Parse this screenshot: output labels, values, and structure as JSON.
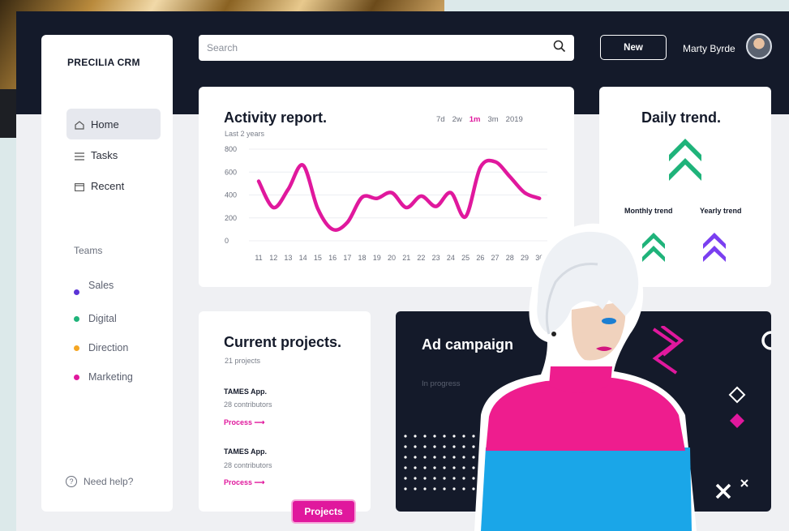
{
  "app": {
    "brand": "PRECILIA CRM"
  },
  "header": {
    "search_placeholder": "Search",
    "new_label": "New",
    "user_name": "Marty Byrde"
  },
  "sidebar": {
    "items": [
      {
        "label": "Home",
        "icon": "home-icon"
      },
      {
        "label": "Tasks",
        "icon": "list-icon"
      },
      {
        "label": "Recent",
        "icon": "recent-icon"
      }
    ],
    "teams_label": "Teams",
    "teams": [
      {
        "label": "Sales",
        "color": "#5b34d6"
      },
      {
        "label": "Digital",
        "color": "#1fb37a"
      },
      {
        "label": "Direction",
        "color": "#f5a623"
      },
      {
        "label": "Marketing",
        "color": "#e0189d"
      }
    ],
    "help_label": "Need help?"
  },
  "activity": {
    "title": "Activity report.",
    "subtitle": "Last 2 years",
    "ranges": [
      "7d",
      "2w",
      "1m",
      "3m",
      "2019"
    ],
    "active_range": "1m"
  },
  "chart_data": {
    "type": "line",
    "title": "Activity report.",
    "x": [
      11,
      12,
      13,
      14,
      15,
      16,
      17,
      18,
      19,
      20,
      21,
      22,
      23,
      24,
      25,
      26,
      27,
      28,
      29,
      30
    ],
    "y_ticks": [
      800,
      600,
      400,
      200,
      0
    ],
    "ylim": [
      0,
      800
    ],
    "series": [
      {
        "color": "#e0189d",
        "values": [
          520,
          290,
          450,
          660,
          280,
          100,
          160,
          380,
          370,
          420,
          290,
          390,
          300,
          420,
          210,
          640,
          690,
          560,
          420,
          370
        ]
      }
    ],
    "grid": true
  },
  "daily": {
    "title": "Daily trend.",
    "monthly_label": "Monthly trend",
    "yearly_label": "Yearly trend",
    "colors": {
      "daily": "#1fb37a",
      "monthly": "#1fb37a",
      "yearly": "#7a3ff0"
    }
  },
  "projects": {
    "title": "Current projects.",
    "count": "21 projects",
    "items": [
      {
        "name": "TAMES App.",
        "meta": "28 contributors",
        "link": "Process ⟶"
      },
      {
        "name": "TAMES App.",
        "meta": "28 contributors",
        "link": "Process ⟶"
      }
    ],
    "button_label": "Projects"
  },
  "ad": {
    "title": "Ad campaign",
    "status": "In progress"
  },
  "colors": {
    "accent": "#e0189d",
    "dark": "#141a2a",
    "green": "#1fb37a",
    "purple": "#7a3ff0"
  }
}
